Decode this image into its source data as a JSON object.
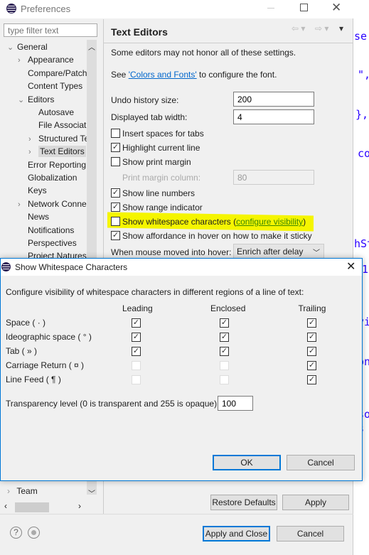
{
  "editor_fragments": [
    "se",
    "\",",
    "},",
    "co",
    "hSt",
    "$1",
    "vi",
    "on",
    "so",
    "s"
  ],
  "prefs": {
    "title": "Preferences",
    "filter_placeholder": "type filter text",
    "tree": [
      {
        "label": "General",
        "level": 0,
        "arrow": "down"
      },
      {
        "label": "Appearance",
        "level": 1,
        "arrow": "right"
      },
      {
        "label": "Compare/Patch",
        "level": 1,
        "arrow": ""
      },
      {
        "label": "Content Types",
        "level": 1,
        "arrow": ""
      },
      {
        "label": "Editors",
        "level": 1,
        "arrow": "down"
      },
      {
        "label": "Autosave",
        "level": 2,
        "arrow": ""
      },
      {
        "label": "File Associat",
        "level": 2,
        "arrow": ""
      },
      {
        "label": "Structured Te",
        "level": 2,
        "arrow": "right"
      },
      {
        "label": "Text Editors",
        "level": 2,
        "arrow": "right",
        "selected": true
      },
      {
        "label": "Error Reporting",
        "level": 1,
        "arrow": ""
      },
      {
        "label": "Globalization",
        "level": 1,
        "arrow": ""
      },
      {
        "label": "Keys",
        "level": 1,
        "arrow": ""
      },
      {
        "label": "Network Conne",
        "level": 1,
        "arrow": "right"
      },
      {
        "label": "News",
        "level": 1,
        "arrow": ""
      },
      {
        "label": "Notifications",
        "level": 1,
        "arrow": ""
      },
      {
        "label": "Perspectives",
        "level": 1,
        "arrow": ""
      },
      {
        "label": "Project Natures",
        "level": 1,
        "arrow": ""
      }
    ],
    "tree_bottom": {
      "label": "Team"
    },
    "page_title": "Text Editors",
    "note": "Some editors may not honor all of these settings.",
    "see_prefix": "See ",
    "see_link": "'Colors and Fonts'",
    "see_suffix": " to configure the font.",
    "undo_label": "Undo history size:",
    "undo_value": "200",
    "tab_label": "Displayed tab width:",
    "tab_value": "4",
    "checks": [
      {
        "label": "Insert spaces for tabs",
        "checked": false
      },
      {
        "label": "Highlight current line",
        "checked": true
      },
      {
        "label": "Show print margin",
        "checked": false
      }
    ],
    "margin_label": "Print margin column:",
    "margin_value": "80",
    "checks2": [
      {
        "label": "Show line numbers",
        "checked": true
      },
      {
        "label": "Show range indicator",
        "checked": true
      }
    ],
    "whitespace_label": "Show whitespace characters (",
    "whitespace_link": "configure visibility",
    "whitespace_close": ")",
    "whitespace_checked": false,
    "highlight_color": "#f5f500",
    "affordance_label": "Show affordance in hover on how to make it sticky",
    "affordance_checked": true,
    "hover_label": "When mouse moved into hover:",
    "hover_value": "Enrich after delay",
    "restore_defaults": "Restore Defaults",
    "apply": "Apply",
    "apply_close": "Apply and Close",
    "cancel": "Cancel"
  },
  "dialog": {
    "title": "Show Whitespace Characters",
    "intro": "Configure visibility of whitespace characters in different regions of a line of text:",
    "columns": [
      "Leading",
      "Enclosed",
      "Trailing"
    ],
    "rows": [
      {
        "label": "Space ( · )",
        "values": [
          true,
          true,
          true
        ],
        "enabled": [
          true,
          true,
          true
        ]
      },
      {
        "label": "Ideographic space ( ° )",
        "values": [
          true,
          true,
          true
        ],
        "enabled": [
          true,
          true,
          true
        ]
      },
      {
        "label": "Tab ( » )",
        "values": [
          true,
          true,
          true
        ],
        "enabled": [
          true,
          true,
          true
        ]
      },
      {
        "label": "Carriage Return ( ¤ )",
        "values": [
          false,
          false,
          true
        ],
        "enabled": [
          false,
          false,
          true
        ]
      },
      {
        "label": "Line Feed ( ¶ )",
        "values": [
          false,
          false,
          true
        ],
        "enabled": [
          false,
          false,
          true
        ]
      }
    ],
    "transparency_label": "Transparency level (0 is transparent and 255 is opaque):",
    "transparency_value": "100",
    "ok": "OK",
    "cancel": "Cancel"
  }
}
